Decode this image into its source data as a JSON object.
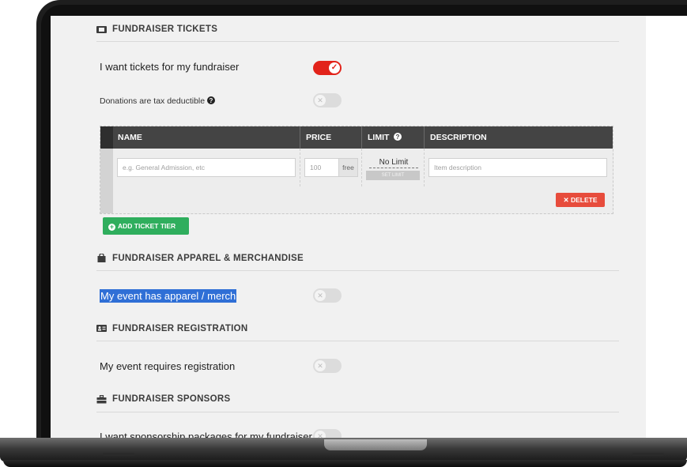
{
  "tickets": {
    "heading": "FUNDRAISER TICKETS",
    "want_tickets_label": "I want tickets for my fundraiser",
    "tax_deductible_label": "Donations are tax deductible",
    "table": {
      "columns": [
        "NAME",
        "PRICE",
        "LIMIT",
        "DESCRIPTION"
      ],
      "row": {
        "name_placeholder": "e.g. General Admission, etc",
        "price_placeholder": "100",
        "price_addon": "free",
        "limit_value": "No Limit",
        "set_limit_label": "SET LIMIT",
        "description_placeholder": "Item description"
      },
      "delete_label": "DELETE"
    },
    "add_tier_label": "ADD TICKET TIER"
  },
  "apparel": {
    "heading": "FUNDRAISER APPAREL & MERCHANDISE",
    "label": "My event has apparel / merch"
  },
  "registration": {
    "heading": "FUNDRAISER REGISTRATION",
    "label": "My event requires registration"
  },
  "sponsors": {
    "heading": "FUNDRAISER SPONSORS",
    "label": "I want sponsorship packages for my fundraiser"
  },
  "colors": {
    "toggle_on": "#e2231a",
    "delete_button": "#e74c3c",
    "add_button": "#2fae5d",
    "table_header": "#444444",
    "selection": "#2f6fd6"
  }
}
